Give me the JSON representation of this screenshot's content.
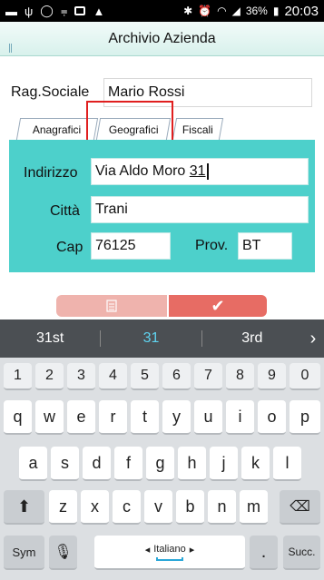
{
  "status_bar": {
    "time": "20:03",
    "battery": "36%",
    "icons": [
      "messenger-icon",
      "usb-icon",
      "whatsapp-icon",
      "voicemail-icon",
      "image-icon",
      "warning-icon",
      "bluetooth-icon",
      "alarm-icon",
      "wifi-icon",
      "signal-icon",
      "battery-icon"
    ]
  },
  "app": {
    "title": "Archivio Azienda"
  },
  "form": {
    "rag_sociale_label": "Rag.Sociale",
    "rag_sociale_value": "Mario Rossi",
    "tabs": [
      {
        "label": "Anagrafici"
      },
      {
        "label": "Geografici"
      },
      {
        "label": "Fiscali"
      }
    ],
    "indirizzo_label": "Indirizzo",
    "indirizzo_value_prefix": "Via Aldo Moro ",
    "indirizzo_value_underlined": "31",
    "citta_label": "Città",
    "citta_value": "Trani",
    "cap_label": "Cap",
    "cap_value": "76125",
    "prov_label": "Prov.",
    "prov_value": "BT"
  },
  "keyboard": {
    "suggestions": [
      "31st",
      "31",
      "3rd"
    ],
    "row_numbers": [
      "1",
      "2",
      "3",
      "4",
      "5",
      "6",
      "7",
      "8",
      "9",
      "0"
    ],
    "row1": [
      "q",
      "w",
      "e",
      "r",
      "t",
      "y",
      "u",
      "i",
      "o",
      "p"
    ],
    "row2": [
      "a",
      "s",
      "d",
      "f",
      "g",
      "h",
      "j",
      "k",
      "l"
    ],
    "row3": [
      "z",
      "x",
      "c",
      "v",
      "b",
      "n",
      "m"
    ],
    "sym_label": "Sym",
    "language_label": "Italiano",
    "next_label": "Succ.",
    "period_label": "."
  },
  "colors": {
    "panel": "#4dd0cb",
    "highlight": "#e01f1f",
    "confirm": "#e76c64",
    "suggestion_active": "#5fd4f0"
  }
}
